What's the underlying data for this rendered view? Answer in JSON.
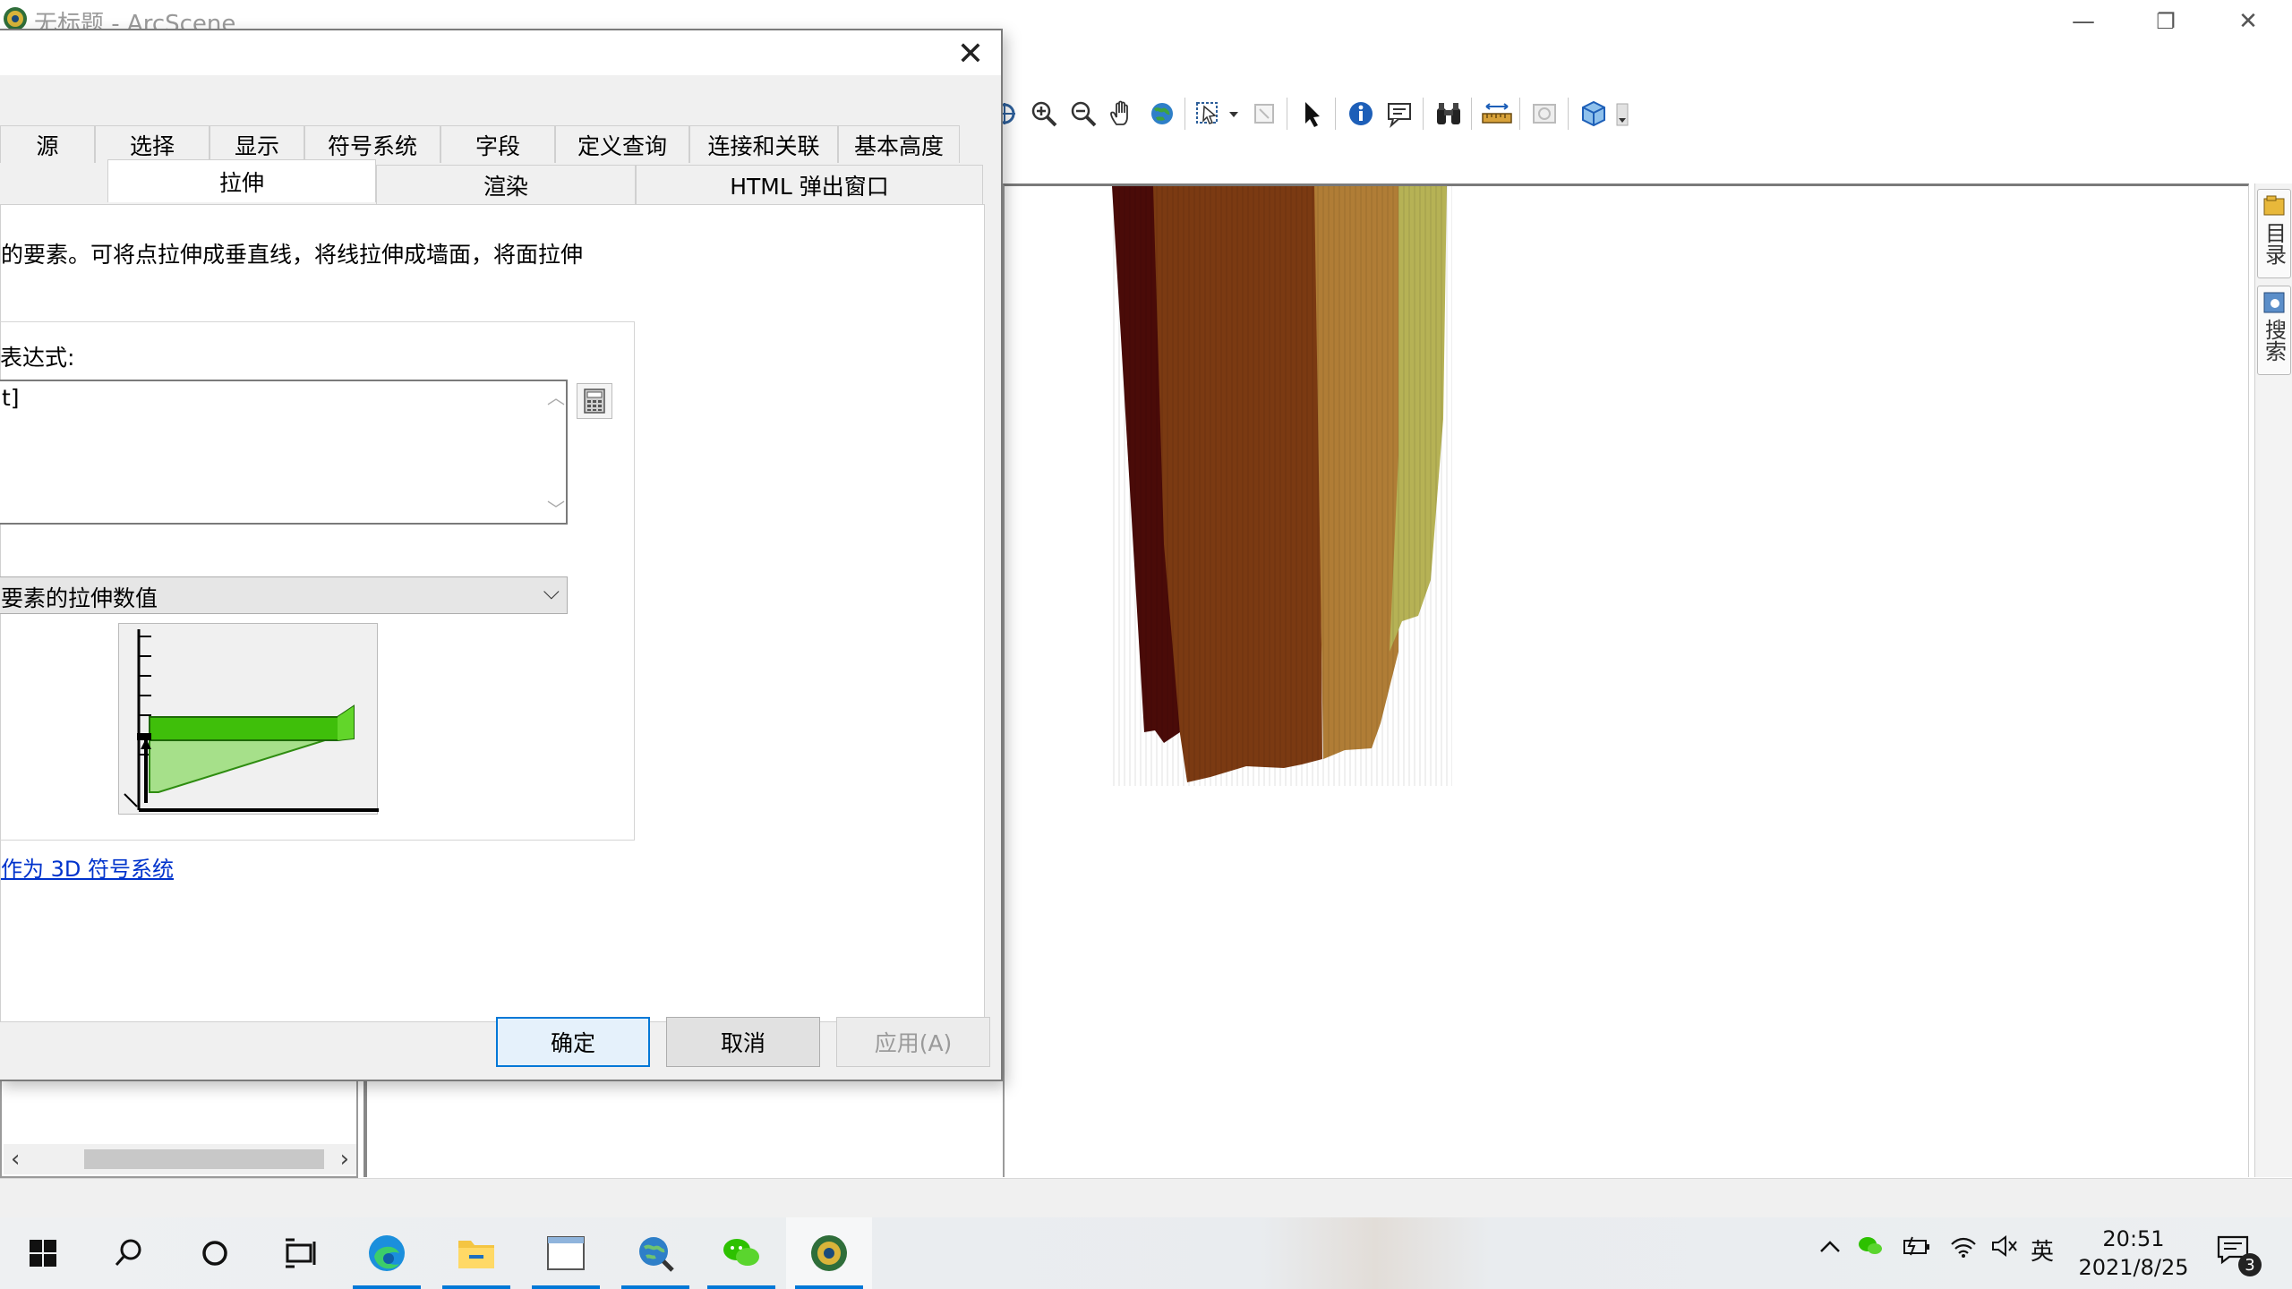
{
  "app": {
    "title": "无标题 - ArcScene"
  },
  "window_controls": {
    "minimize": "—",
    "restore": "❐",
    "close": "✕"
  },
  "dialog": {
    "close_glyph": "✕",
    "tabs_row1": [
      {
        "label": "源",
        "width": 106
      },
      {
        "label": "选择",
        "width": 128
      },
      {
        "label": "显示",
        "width": 106
      },
      {
        "label": "符号系统",
        "width": 152
      },
      {
        "label": "字段",
        "width": 128
      },
      {
        "label": "定义查询",
        "width": 150
      },
      {
        "label": "连接和关联",
        "width": 166
      },
      {
        "label": "基本高度",
        "width": 136
      }
    ],
    "tabs_row2": [
      {
        "label": "拉伸",
        "active": true
      },
      {
        "label": "渲染",
        "active": false
      },
      {
        "label": "HTML 弹出窗口",
        "active": false
      }
    ],
    "extrusion": {
      "description": "的要素。可将点拉伸成垂直线，将线拉伸成墙面，将面拉伸",
      "expression_label": "表达式:",
      "expression_value": "t]",
      "apply_value": "要素的拉伸数值",
      "link_label": "作为 3D 符号系统"
    },
    "buttons": {
      "ok": "确定",
      "cancel": "取消",
      "apply": "应用(A)"
    }
  },
  "side_dock": {
    "catalog": "目录",
    "search": "搜索"
  },
  "taskbar": {
    "tray_ime": "英",
    "time": "20:51",
    "date": "2021/8/25",
    "notification_count": "3"
  },
  "colors": {
    "accent": "#0078d7",
    "link": "#0033cc",
    "extrude_dark": "#4a0b08",
    "extrude_brown": "#7b3a12",
    "extrude_tan": "#b07d36",
    "extrude_olive": "#b6b255",
    "preview_green": "#3fbf0a"
  }
}
